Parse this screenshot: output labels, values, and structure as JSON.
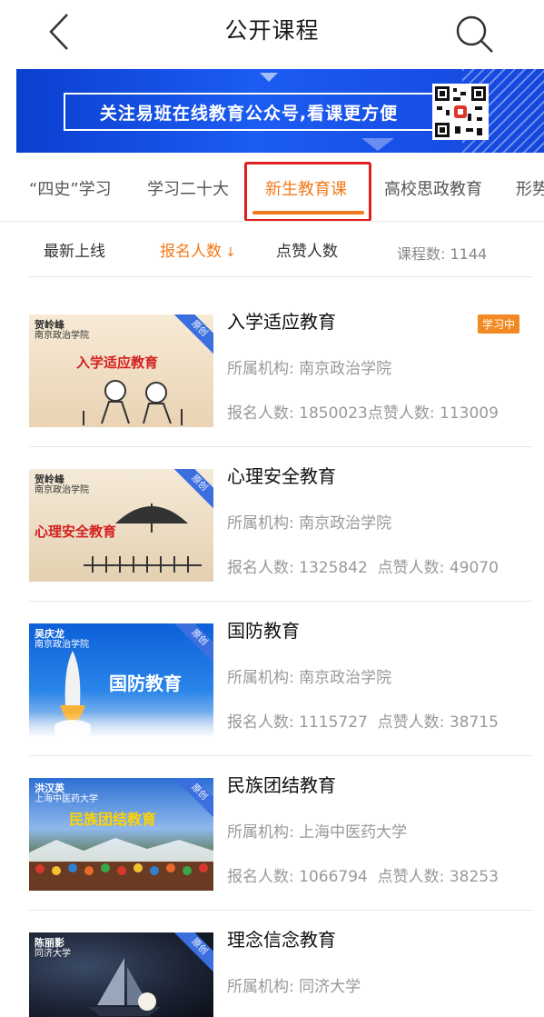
{
  "header": {
    "title": "公开课程"
  },
  "banner": {
    "text": "关注易班在线教育公众号,看课更方便"
  },
  "tabs": [
    {
      "label": "“四史”学习"
    },
    {
      "label": "学习二十大"
    },
    {
      "label": "新生教育课"
    },
    {
      "label": "高校思政教育"
    },
    {
      "label": "形势"
    }
  ],
  "sort": {
    "latest": "最新上线",
    "signups": "报名人数",
    "signups_arrow": "↓",
    "likes": "点赞人数",
    "count_label": "课程数:",
    "count_value": "1144"
  },
  "courses": [
    {
      "title": "入学适应教育",
      "badge": "学习中",
      "org_label": "所属机构:",
      "org": "南京政治学院",
      "signups_label": "报名人数:",
      "signups": "1850023",
      "likes_label": "点赞人数:",
      "likes": "113009",
      "thumb": {
        "author": "贺岭峰",
        "school": "南京政治学院",
        "title": "入学适应教育",
        "ribbon": "原创"
      }
    },
    {
      "title": "心理安全教育",
      "org_label": "所属机构:",
      "org": "南京政治学院",
      "signups_label": "报名人数:",
      "signups": "1325842",
      "likes_label": "点赞人数:",
      "likes": "49070",
      "thumb": {
        "author": "贺岭峰",
        "school": "南京政治学院",
        "title": "心理安全教育",
        "ribbon": "原创"
      }
    },
    {
      "title": "国防教育",
      "org_label": "所属机构:",
      "org": "南京政治学院",
      "signups_label": "报名人数:",
      "signups": "1115727",
      "likes_label": "点赞人数:",
      "likes": "38715",
      "thumb": {
        "author": "吴庆龙",
        "school": "南京政治学院",
        "title": "国防教育",
        "ribbon": "原创"
      }
    },
    {
      "title": "民族团结教育",
      "org_label": "所属机构:",
      "org": "上海中医药大学",
      "signups_label": "报名人数:",
      "signups": "1066794",
      "likes_label": "点赞人数:",
      "likes": "38253",
      "thumb": {
        "author": "洪汉英",
        "school": "上海中医药大学",
        "title": "民族团结教育",
        "ribbon": "原创"
      }
    },
    {
      "title": "理念信念教育",
      "org_label": "所属机构:",
      "org": "同济大学",
      "thumb": {
        "author": "陈丽影",
        "school": "同济大学",
        "ribbon": "原创"
      }
    }
  ],
  "colors": {
    "accent": "#f27a1a",
    "highlight_box": "#e02020",
    "banner_blue": "#1c5cf2"
  }
}
